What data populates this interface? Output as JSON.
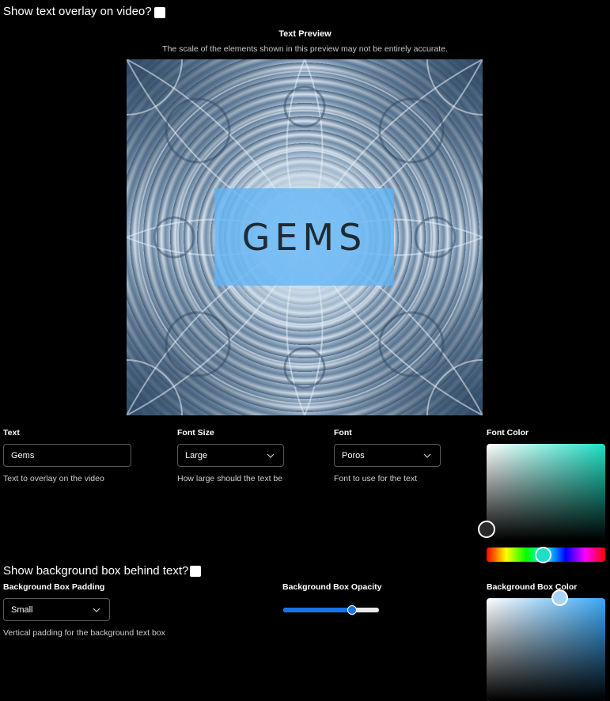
{
  "header": {
    "show_overlay_label": "Show text overlay on video?"
  },
  "preview": {
    "title": "Text Preview",
    "note": "The scale of the elements shown in this preview may not be entirely accurate.",
    "overlay_text": "GEMS"
  },
  "fields": {
    "text": {
      "label": "Text",
      "value": "Gems",
      "helper": "Text to overlay on the video"
    },
    "font_size": {
      "label": "Font Size",
      "value": "Large",
      "helper": "How large should the text be"
    },
    "font": {
      "label": "Font",
      "value": "Poros",
      "helper": "Font to use for the text"
    },
    "font_color": {
      "label": "Font Color",
      "hue": "#1de0c6"
    }
  },
  "background": {
    "show_box_label": "Show background box behind text?",
    "padding": {
      "label": "Background Box Padding",
      "value": "Small",
      "helper": "Vertical padding for the background text box"
    },
    "opacity": {
      "label": "Background Box Opacity",
      "value": 0.72
    },
    "color": {
      "label": "Background Box Color",
      "hue": "#3aa7f5"
    }
  },
  "icons": {
    "chevron": "chevron-down-icon"
  }
}
